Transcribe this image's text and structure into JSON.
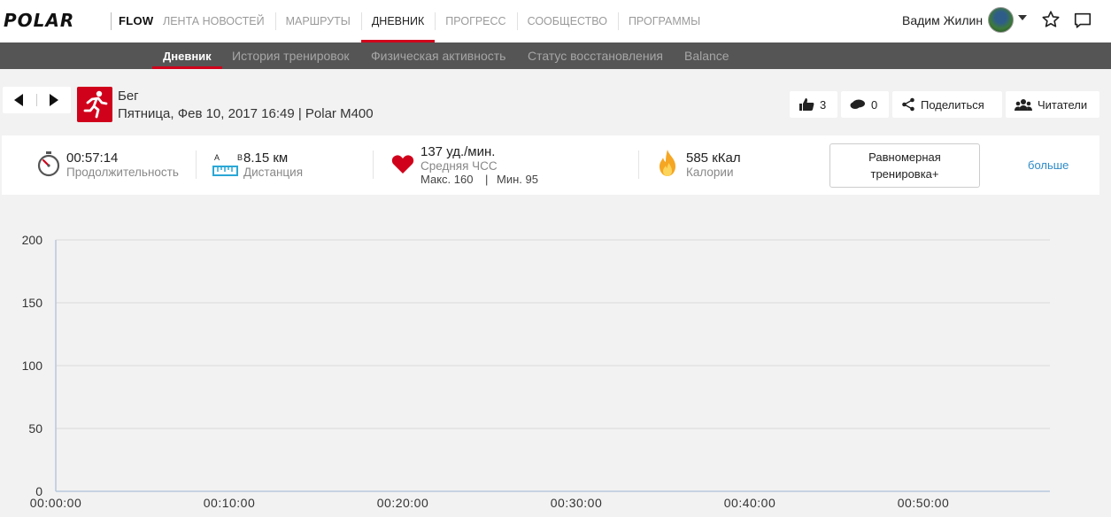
{
  "app": {
    "logo": "POLAR",
    "product": "FLOW",
    "nav": [
      "ЛЕНТА НОВОСТЕЙ",
      "МАРШРУТЫ",
      "ДНЕВНИК",
      "ПРОГРЕСС",
      "СООБЩЕСТВО",
      "ПРОГРАММЫ"
    ],
    "nav_active": "ДНЕВНИК",
    "user_name": "Вадим Жилин"
  },
  "subnav": {
    "items": [
      "Дневник",
      "История тренировок",
      "Физическая активность",
      "Статус восстановления",
      "Balance"
    ],
    "active": "Дневник"
  },
  "activity": {
    "sport": "Бег",
    "details": "Пятница, Фев 10, 2017 16:49 | Polar M400",
    "likes": "3",
    "comments": "0",
    "share_label": "Поделиться",
    "followers_label": "Читатели"
  },
  "summary": {
    "duration": {
      "value": "00:57:14",
      "label": "Продолжительность"
    },
    "distance": {
      "ab": "A B",
      "value": "8.15 км",
      "label": "Дистанция"
    },
    "heart_rate": {
      "value": "137 уд./мин.",
      "label": "Средняя ЧСС",
      "max": "Макс. 160",
      "min": "Мин. 95",
      "sep": "|"
    },
    "calories": {
      "value": "585 кКал",
      "label": "Калории"
    },
    "zone_button": [
      "Равномерная",
      "тренировка+"
    ],
    "more_link": "больше"
  },
  "chart_data": {
    "type": "line",
    "title": "",
    "xlabel": "",
    "ylabel": "",
    "ylim": [
      0,
      200
    ],
    "yticks": [
      0,
      50,
      100,
      150,
      200
    ],
    "xticks": [
      "00:00:00",
      "00:10:00",
      "00:20:00",
      "00:30:00",
      "00:40:00",
      "00:50:00"
    ],
    "grid": true,
    "series": []
  },
  "colors": {
    "accent": "#d0021b",
    "subnav_bg": "#555555",
    "link": "#2e8bc7",
    "distance_icon": "#2aa7d6",
    "heart_icon": "#d0021b",
    "flame_icon": "#f5a623"
  }
}
